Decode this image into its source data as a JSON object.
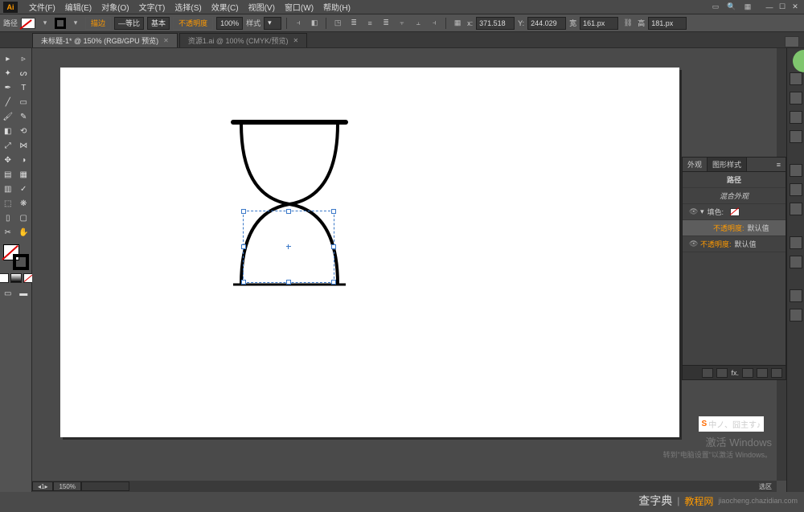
{
  "menubar": {
    "logo": "Ai",
    "items": [
      "文件(F)",
      "编辑(E)",
      "对象(O)",
      "文字(T)",
      "选择(S)",
      "效果(C)",
      "视图(V)",
      "窗口(W)",
      "帮助(H)"
    ]
  },
  "control": {
    "path_label": "路径",
    "stroke_label": "描边",
    "stroke_val": "—等比",
    "basic": "基本",
    "opacity_label": "不透明度",
    "opacity_val": "100%",
    "style": "样式",
    "x_label": "x:",
    "x_val": "371.518",
    "y_label": "Y:",
    "y_val": "244.029",
    "w_label": "宽",
    "w_val": "161.px",
    "h_label": "高",
    "h_val": "181.px"
  },
  "tabs": {
    "active": "未标题-1* @ 150% (RGB/GPU 预览)",
    "inactive": "资源1.ai @ 100% (CMYK/预览)"
  },
  "panel": {
    "tab1": "外观",
    "tab2": "图形样式",
    "header": "路径",
    "row2": "混合外观",
    "row3_l": "填色:",
    "row4_a": "不透明度:",
    "row4_b": "默认值",
    "row5_a": "不透明度:",
    "row5_b": "默认值",
    "fx": "fx."
  },
  "status": {
    "artboard_no": "1",
    "zoom": "150%",
    "sel": "选区"
  },
  "watermark": {
    "l1": "激活 Windows",
    "l2": "转到\"电脑设置\"以激活 Windows。"
  },
  "badge": "中ノ、囧主す♪",
  "footer": {
    "brand": "查字典",
    "pipe": "|",
    "section": "教程网",
    "url": "jiaocheng.chazidian.com"
  },
  "tool_names": [
    "selection",
    "direct-selection",
    "magic-wand",
    "lasso",
    "pen",
    "curvature",
    "type",
    "line",
    "rectangle",
    "paintbrush",
    "pencil",
    "eraser",
    "rotate",
    "scale",
    "width",
    "free-transform",
    "shape-builder",
    "perspective",
    "mesh",
    "gradient",
    "eyedropper",
    "blend",
    "symbol-sprayer",
    "column-graph",
    "artboard",
    "slice",
    "hand",
    "zoom"
  ]
}
